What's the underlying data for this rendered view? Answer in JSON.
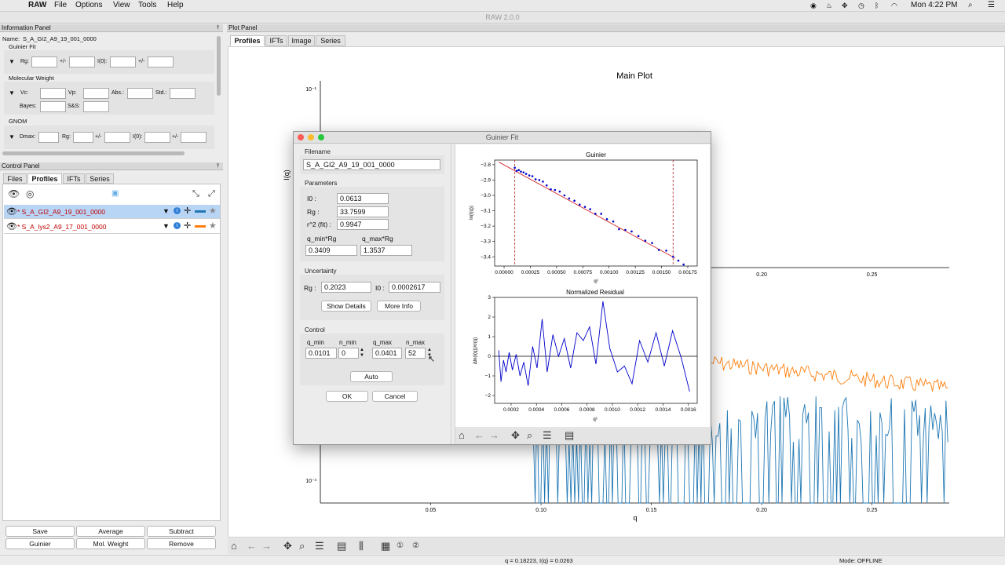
{
  "menubar": {
    "app": "RAW",
    "items": [
      "File",
      "Options",
      "View",
      "Tools",
      "Help"
    ],
    "clock": "Mon 4:22 PM"
  },
  "window_title": "RAW 2.0.0",
  "info_panel": {
    "title": "Information Panel",
    "name_label": "Name:",
    "name_value": "S_A_GI2_A9_19_001_0000",
    "guinier_section": "Guinier Fit",
    "rg_label": "Rg:",
    "pm1": "+/-",
    "i0_label": "I(0):",
    "pm2": "+/-",
    "mw_section": "Molecular Weight",
    "vc_label": "Vc:",
    "vp_label": "Vp:",
    "abs_label": "Abs.:",
    "std_label": "Std.:",
    "bayes_label": "Bayes:",
    "ss_label": "S&S:",
    "gnom_section": "GNOM",
    "dmax_label": "Dmax:",
    "grg_label": "Rg:",
    "gpm1": "+/-",
    "gi0_label": "I(0):",
    "gpm2": "+/-"
  },
  "control_panel": {
    "title": "Control Panel",
    "tabs": [
      "Files",
      "Profiles",
      "IFTs",
      "Series"
    ],
    "profiles": [
      {
        "name": "* S_A_GI2_A9_19_001_0000",
        "color": "#1f77b4",
        "selected": true
      },
      {
        "name": "* S_A_lys2_A9_17_001_0000",
        "color": "#ff7f0e",
        "selected": false
      }
    ],
    "buttons": [
      "Save",
      "Average",
      "Subtract",
      "Guinier",
      "Mol. Weight",
      "Remove"
    ]
  },
  "plot_panel": {
    "title": "Plot Panel",
    "tabs": [
      "Profiles",
      "IFTs",
      "Image",
      "Series"
    ],
    "main_title": "Main Plot",
    "ylabel": "I(q)",
    "xlabel": "q",
    "ytick_top": "10⁻¹",
    "ytick_bottom": "10⁻³",
    "xticks": [
      "0.05",
      "0.10",
      "0.15",
      "0.20",
      "0.25"
    ],
    "xticks_visible": [
      "0.20",
      "0.25"
    ]
  },
  "status_bar": {
    "coords": "q = 0.18223, I(q) = 0.0263",
    "mode": "Mode: OFFLINE"
  },
  "guinier_dialog": {
    "title": "Guinier Fit",
    "filename_label": "Filename",
    "filename": "S_A_GI2_A9_19_001_0000",
    "parameters_label": "Parameters",
    "i0_label": "I0 :",
    "i0": "0.0613",
    "rg_label": "Rg :",
    "rg": "33.7599",
    "r2_label": "r^2 (fit) :",
    "r2": "0.9947",
    "qminrg_label": "q_min*Rg",
    "qmaxrg_label": "q_max*Rg",
    "qminrg": "0.3409",
    "qmaxrg": "1.3537",
    "uncertainty_label": "Uncertainty",
    "urg_label": "Rg :",
    "urg": "0.2023",
    "ui0_label": "I0 :",
    "ui0": "0.0002617",
    "show_details": "Show Details",
    "more_info": "More Info",
    "control_label": "Control",
    "qmin_label": "q_min",
    "nmin_label": "n_min",
    "qmax_label": "q_max",
    "nmax_label": "n_max",
    "qmin": "0.0101",
    "nmin": "0",
    "qmax": "0.0401",
    "nmax": "52",
    "auto": "Auto",
    "ok": "OK",
    "cancel": "Cancel",
    "guinier_plot": {
      "title": "Guinier",
      "ylabel": "ln(I(q))",
      "xlabel": "q²",
      "yticks": [
        "−2.8",
        "−2.9",
        "−3.0",
        "−3.1",
        "−3.2",
        "−3.3",
        "−3.4"
      ],
      "xticks": [
        "0.00000",
        "0.00025",
        "0.00050",
        "0.00075",
        "0.00100",
        "0.00125",
        "0.00150",
        "0.00175"
      ]
    },
    "residual_plot": {
      "title": "Normalized Residual",
      "ylabel": "Δln(I(q))/σ(q)",
      "xlabel": "q²",
      "yticks": [
        "3",
        "2",
        "1",
        "0",
        "−1",
        "−2"
      ],
      "xticks": [
        "0.0002",
        "0.0004",
        "0.0006",
        "0.0008",
        "0.0010",
        "0.0012",
        "0.0014",
        "0.0016"
      ]
    }
  },
  "chart_data": [
    {
      "type": "scatter",
      "title": "Guinier",
      "xlabel": "q²",
      "ylabel": "ln(I(q))",
      "xlim": [
        -9e-05,
        0.00184
      ],
      "ylim": [
        -3.46,
        -2.77
      ],
      "fit_line": {
        "x": [
          -5e-05,
          0.00163
        ],
        "y": [
          -2.783,
          -3.409
        ],
        "color": "#d62728"
      },
      "guides": {
        "x": [
          0.000102,
          0.00161
        ],
        "color": "#b22222"
      },
      "x": [
        0.000102,
        0.00012,
        0.00014,
        0.00016,
        0.000185,
        0.00021,
        0.00024,
        0.00027,
        0.0003,
        0.000335,
        0.00037,
        0.000405,
        0.000445,
        0.000485,
        0.00053,
        0.000575,
        0.00062,
        0.00067,
        0.00072,
        0.00077,
        0.00082,
        0.00087,
        0.000925,
        0.00098,
        0.00104,
        0.001095,
        0.001155,
        0.001215,
        0.00128,
        0.001345,
        0.00141,
        0.001475,
        0.001545,
        0.00161,
        0.00166,
        0.00171
      ],
      "y": [
        -2.82,
        -2.84,
        -2.835,
        -2.845,
        -2.85,
        -2.86,
        -2.87,
        -2.875,
        -2.895,
        -2.9,
        -2.91,
        -2.935,
        -2.96,
        -2.965,
        -2.975,
        -3.0,
        -3.02,
        -3.035,
        -3.06,
        -3.075,
        -3.09,
        -3.12,
        -3.12,
        -3.155,
        -3.17,
        -3.22,
        -3.225,
        -3.235,
        -3.265,
        -3.295,
        -3.31,
        -3.355,
        -3.36,
        -3.4,
        -3.425,
        -3.45
      ]
    },
    {
      "type": "line",
      "title": "Normalized Residual",
      "xlabel": "q²",
      "ylabel": "Δln(I(q))/σ(q)",
      "xlim": [
        7e-05,
        0.00167
      ],
      "ylim": [
        -2.4,
        3.0
      ],
      "x": [
        0.000102,
        0.00012,
        0.00014,
        0.00016,
        0.000185,
        0.00021,
        0.00024,
        0.00027,
        0.0003,
        0.000335,
        0.00037,
        0.000405,
        0.000445,
        0.000485,
        0.00053,
        0.000575,
        0.00062,
        0.00067,
        0.00072,
        0.00077,
        0.00082,
        0.00087,
        0.000925,
        0.00098,
        0.00104,
        0.001095,
        0.001155,
        0.001215,
        0.00128,
        0.001345,
        0.00141,
        0.001475,
        0.001545,
        0.00161
      ],
      "y": [
        0.3,
        -1.3,
        -0.2,
        -0.8,
        0.2,
        -0.7,
        0.1,
        -1.0,
        -0.3,
        -1.5,
        0.5,
        -0.6,
        1.9,
        -0.8,
        1.1,
        0.0,
        0.9,
        -0.6,
        1.2,
        0.8,
        1.5,
        -0.4,
        2.8,
        0.4,
        -0.8,
        -0.5,
        -1.4,
        0.8,
        -0.3,
        1.2,
        -0.5,
        1.3,
        -0.1,
        -1.8
      ]
    },
    {
      "type": "line",
      "title": "Main Plot",
      "xlabel": "q",
      "ylabel": "I(q)",
      "xlim": [
        0.0,
        0.285
      ],
      "yscale": "log",
      "series": [
        {
          "name": "* S_A_GI2_A9_19_001_0000",
          "color": "#1f77b4"
        },
        {
          "name": "* S_A_lys2_A9_17_001_0000",
          "color": "#ff7f0e"
        }
      ]
    }
  ]
}
